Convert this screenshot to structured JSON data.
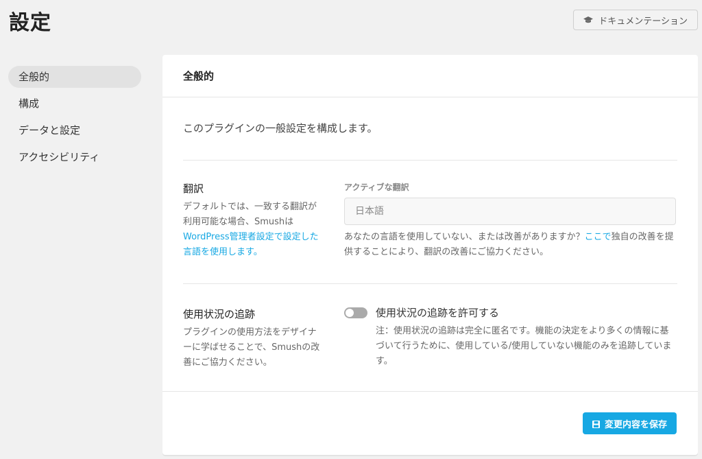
{
  "header": {
    "title": "設定",
    "doc_button_label": "ドキュメンテーション",
    "doc_icon": "graduation-cap-icon"
  },
  "sidebar": {
    "items": [
      {
        "label": "全般的",
        "active": true
      },
      {
        "label": "構成",
        "active": false
      },
      {
        "label": "データと設定",
        "active": false
      },
      {
        "label": "アクセシビリティ",
        "active": false
      }
    ]
  },
  "card": {
    "title": "全般的",
    "description": "このプラグインの一般設定を構成します。",
    "translation": {
      "title": "翻訳",
      "help_prefix": "デフォルトでは、一致する翻訳が利用可能な場合、Smushは",
      "help_link": "WordPress管理者設定で設定した言語を使用します。",
      "field_label": "アクティブな翻訳",
      "field_value": "日本語",
      "field_help_prefix": "あなたの言語を使用していない、または改善がありますか？",
      "field_help_link": "ここで",
      "field_help_suffix": "独自の改善を提供することにより、翻訳の改善にご協力ください。"
    },
    "tracking": {
      "title": "使用状況の追跡",
      "help": "プラグインの使用方法をデザイナーに学ばせることで、Smushの改善にご協力ください。",
      "toggle_label": "使用状況の追跡を許可する",
      "toggle_on": false,
      "note": "注：使用状況の追跡は完全に匿名です。機能の決定をより多くの情報に基づいて行うために、使用している/使用していない機能のみを追跡しています。"
    },
    "save_button_label": "変更内容を保存",
    "save_icon": "save-icon"
  },
  "colors": {
    "accent": "#17a8e3",
    "background": "#f1f1f1"
  }
}
